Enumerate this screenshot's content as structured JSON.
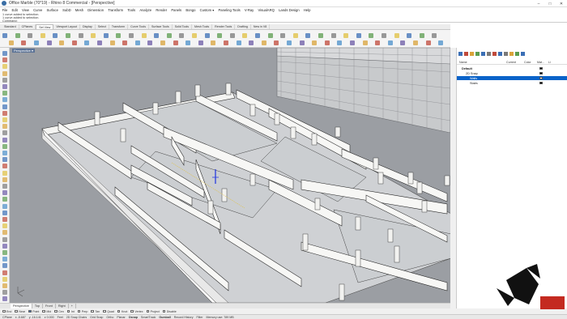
{
  "window": {
    "title": "Office Marble (70*19) - Rhino 8 Commercial - [Perspective]",
    "controls": [
      "–",
      "□",
      "✕"
    ]
  },
  "menu": [
    "File",
    "Edit",
    "View",
    "Curve",
    "Surface",
    "SubD",
    "Mesh",
    "Dimension",
    "Transform",
    "Tools",
    "Analyze",
    "Render",
    "Panels",
    "Bongo",
    "Custom ▾",
    "Paneling Tools",
    "V-Ray",
    "VisualARQ",
    "Lands Design",
    "Help"
  ],
  "command_history": [
    "1 curve added to selection.",
    "1 curve added to selection.",
    "Command:"
  ],
  "toolbar_tabs": [
    {
      "label": "Standard",
      "active": false
    },
    {
      "label": "CPlanes",
      "active": false
    },
    {
      "label": "Set View",
      "active": true
    },
    {
      "label": "Viewport Layout",
      "active": false
    },
    {
      "label": "Display",
      "active": false
    },
    {
      "label": "Select",
      "active": false
    },
    {
      "label": "Transform",
      "active": false
    },
    {
      "label": "Curve Tools",
      "active": false
    },
    {
      "label": "Surface Tools",
      "active": false
    },
    {
      "label": "Solid Tools",
      "active": false
    },
    {
      "label": "Mesh Tools",
      "active": false
    },
    {
      "label": "Render Tools",
      "active": false
    },
    {
      "label": "Drafting",
      "active": false
    },
    {
      "label": "New in V8",
      "active": false
    }
  ],
  "viewport": {
    "label": "Perspective ▾",
    "background": "#9b9ea3"
  },
  "view_tabs": [
    {
      "label": "Perspective",
      "active": true
    },
    {
      "label": "Top",
      "active": false
    },
    {
      "label": "Front",
      "active": false
    },
    {
      "label": "Right",
      "active": false
    },
    {
      "label": "+",
      "active": false
    }
  ],
  "osnaps": [
    {
      "label": "End",
      "checked": false
    },
    {
      "label": "Near",
      "checked": false
    },
    {
      "label": "Point",
      "checked": true
    },
    {
      "label": "Mid",
      "checked": false
    },
    {
      "label": "Cen",
      "checked": false
    },
    {
      "label": "Int",
      "checked": false
    },
    {
      "label": "Perp",
      "checked": false
    },
    {
      "label": "Tan",
      "checked": false
    },
    {
      "label": "Quad",
      "checked": false
    },
    {
      "label": "Knot",
      "checked": false
    },
    {
      "label": "Vertex",
      "checked": false
    },
    {
      "label": "Project",
      "checked": false
    },
    {
      "label": "Disable",
      "checked": false
    }
  ],
  "status": {
    "cplane": "CPlane",
    "x": "x -5.687",
    "y": "y -16.141",
    "z": "z 0.000",
    "units": "Feet",
    "layer": "2D Snap Chairs",
    "items": [
      "Grid Snap",
      "Ortho",
      "Planar",
      "Osnap",
      "SmartTrack",
      "Gumball",
      "Record History",
      "Filter"
    ],
    "bold_items": [
      "Osnap",
      "Gumball"
    ],
    "memory": "Memory use: 789 MB"
  },
  "layers": {
    "columns": [
      "Name",
      "Current",
      "Color",
      "Mat...",
      "Li"
    ],
    "rows": [
      {
        "name": "Default",
        "indent": 0,
        "selected": false,
        "color": "#000000",
        "bold": true
      },
      {
        "name": "2D Snap",
        "indent": 1,
        "selected": false,
        "color": "#000000",
        "bold": false
      },
      {
        "name": "Walls",
        "indent": 2,
        "selected": true,
        "color": "#ffffff",
        "bold": false
      },
      {
        "name": "Stairs",
        "indent": 2,
        "selected": false,
        "color": "#000000",
        "bold": false
      }
    ]
  },
  "colors": {
    "accent": "#0a63c9",
    "viewport_label_bg": "#5c7396",
    "brand_red": "#c42a20"
  }
}
